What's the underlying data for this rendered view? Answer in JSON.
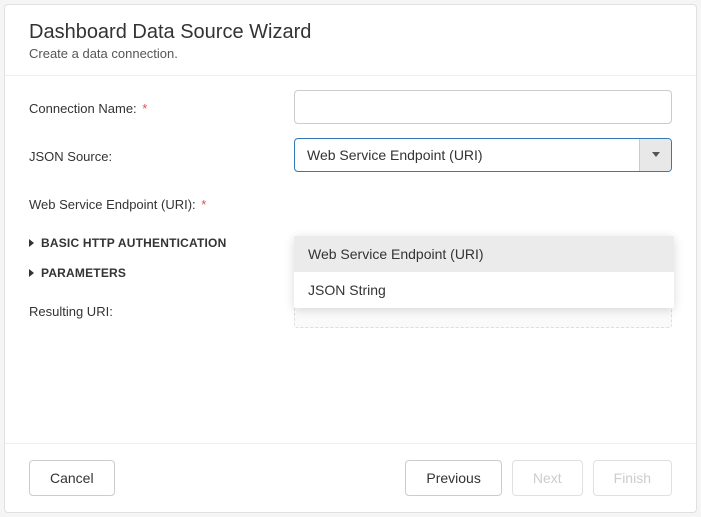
{
  "header": {
    "title": "Dashboard Data Source Wizard",
    "subtitle": "Create a data connection."
  },
  "form": {
    "connectionName": {
      "label": "Connection Name:",
      "required": "*",
      "value": ""
    },
    "jsonSource": {
      "label": "JSON Source:",
      "selected": "Web Service Endpoint (URI)",
      "options": [
        "Web Service Endpoint (URI)",
        "JSON String"
      ]
    },
    "endpoint": {
      "label": "Web Service Endpoint (URI):",
      "required": "*",
      "value": ""
    },
    "authSection": "BASIC HTTP AUTHENTICATION",
    "paramsSection": "PARAMETERS",
    "resulting": {
      "label": "Resulting URI:"
    }
  },
  "footer": {
    "cancel": "Cancel",
    "previous": "Previous",
    "next": "Next",
    "finish": "Finish"
  }
}
